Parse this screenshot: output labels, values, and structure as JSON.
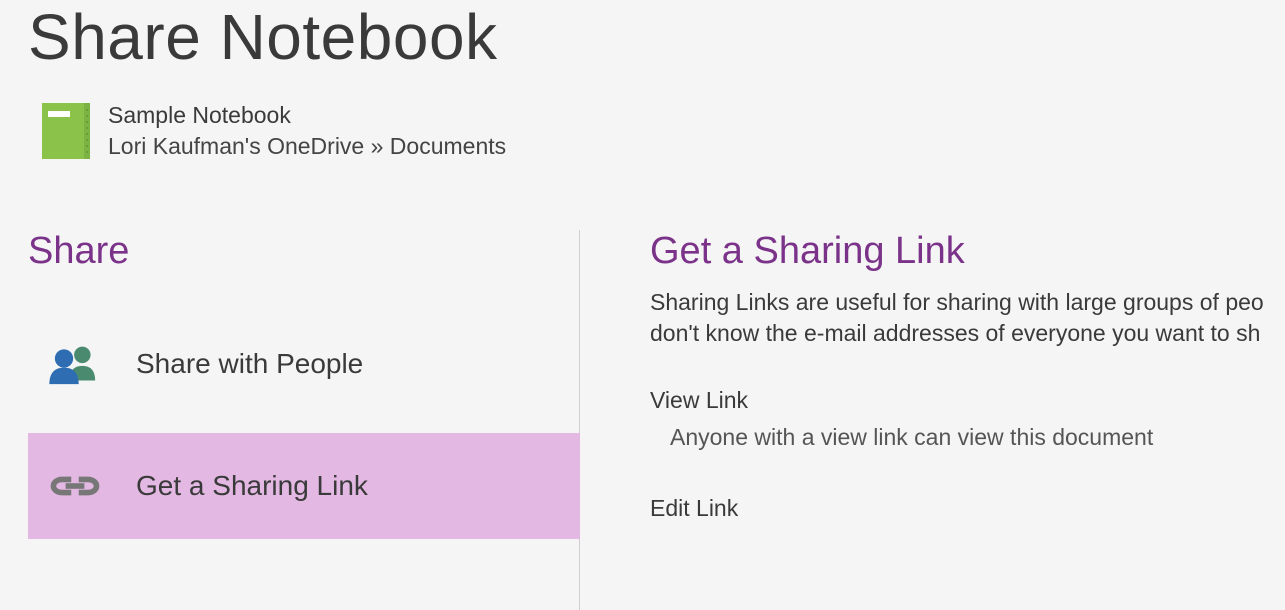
{
  "page": {
    "title": "Share Notebook"
  },
  "notebook": {
    "name": "Sample Notebook",
    "path": "Lori Kaufman's OneDrive » Documents"
  },
  "sidebar": {
    "heading": "Share",
    "options": [
      {
        "label": "Share with People"
      },
      {
        "label": "Get a Sharing Link"
      }
    ]
  },
  "main": {
    "heading": "Get a Sharing Link",
    "description": "Sharing Links are useful for sharing with large groups of peo don't know the e-mail addresses of everyone you want to sh",
    "viewLink": {
      "label": "View Link",
      "description": "Anyone with a view link can view this document"
    },
    "editLink": {
      "label": "Edit Link"
    }
  }
}
